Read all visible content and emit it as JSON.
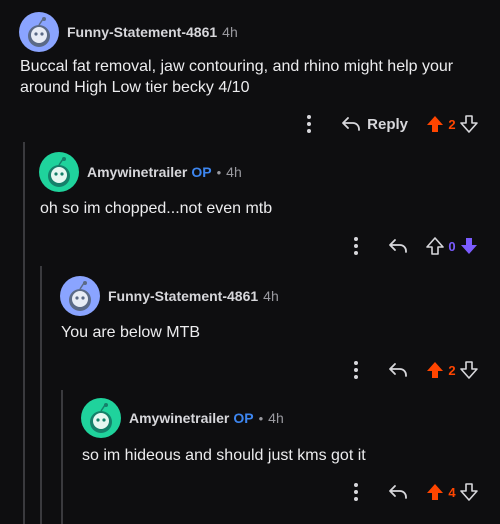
{
  "colors": {
    "upvote": "#ff4500",
    "downvote": "#7b5cff",
    "op": "#3d86f0",
    "avatar_blue": "#8aa4ff",
    "avatar_teal": "#1fd39c"
  },
  "comments": [
    {
      "author": "Funny-Statement-4861",
      "op_badge": "",
      "age": "4h",
      "body": "Buccal fat removal, jaw contouring, and rhino might help your around High Low tier becky 4/10",
      "reply_label": "Reply",
      "score": "2",
      "vote": "up",
      "avatar_icon": "snoo-blue-icon"
    },
    {
      "author": "Amywinetrailer",
      "op_badge": "OP",
      "dot": "•",
      "age": "4h",
      "body": "oh so im chopped...not even mtb",
      "score": "0",
      "vote": "down",
      "avatar_icon": "snoo-teal-icon"
    },
    {
      "author": "Funny-Statement-4861",
      "op_badge": "",
      "age": "4h",
      "body": "You are below MTB",
      "score": "2",
      "vote": "up",
      "avatar_icon": "snoo-blue-icon"
    },
    {
      "author": "Amywinetrailer",
      "op_badge": "OP",
      "dot": "•",
      "age": "4h",
      "body": "so im hideous and should just kms got it",
      "score": "4",
      "vote": "up",
      "avatar_icon": "snoo-teal-icon"
    }
  ]
}
